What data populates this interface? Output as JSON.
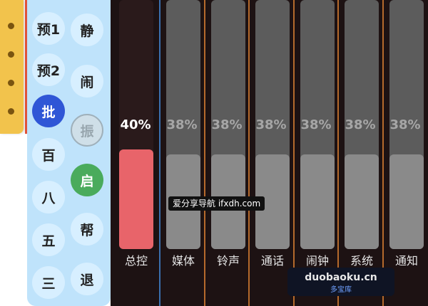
{
  "quick_panel": {
    "left": [
      "预1",
      "预2",
      "批",
      "百",
      "八",
      "五",
      "三"
    ],
    "right": [
      "静",
      "闹",
      "振",
      "启",
      "帮",
      "退"
    ]
  },
  "mixer": {
    "channels": [
      {
        "label": "总控",
        "percent_text": "40%",
        "level": 0.4
      },
      {
        "label": "媒体",
        "percent_text": "38%",
        "level": 0.38
      },
      {
        "label": "铃声",
        "percent_text": "38%",
        "level": 0.38
      },
      {
        "label": "通话",
        "percent_text": "38%",
        "level": 0.38
      },
      {
        "label": "闹钟",
        "percent_text": "38%",
        "level": 0.38
      },
      {
        "label": "系统",
        "percent_text": "38%",
        "level": 0.38
      },
      {
        "label": "通知",
        "percent_text": "38%",
        "level": 0.38
      }
    ]
  },
  "watermark": {
    "overlay_text": "爱分享导航 ifxdh.com",
    "site": "duobaoku.cn",
    "site_sub": "多宝库"
  },
  "colors": {
    "master_fill": "#e8646a",
    "panel_bg": "#bfe3fb",
    "active_button": "#2f56d6",
    "green_button": "#4aab5c",
    "handle": "#f2c34c"
  }
}
